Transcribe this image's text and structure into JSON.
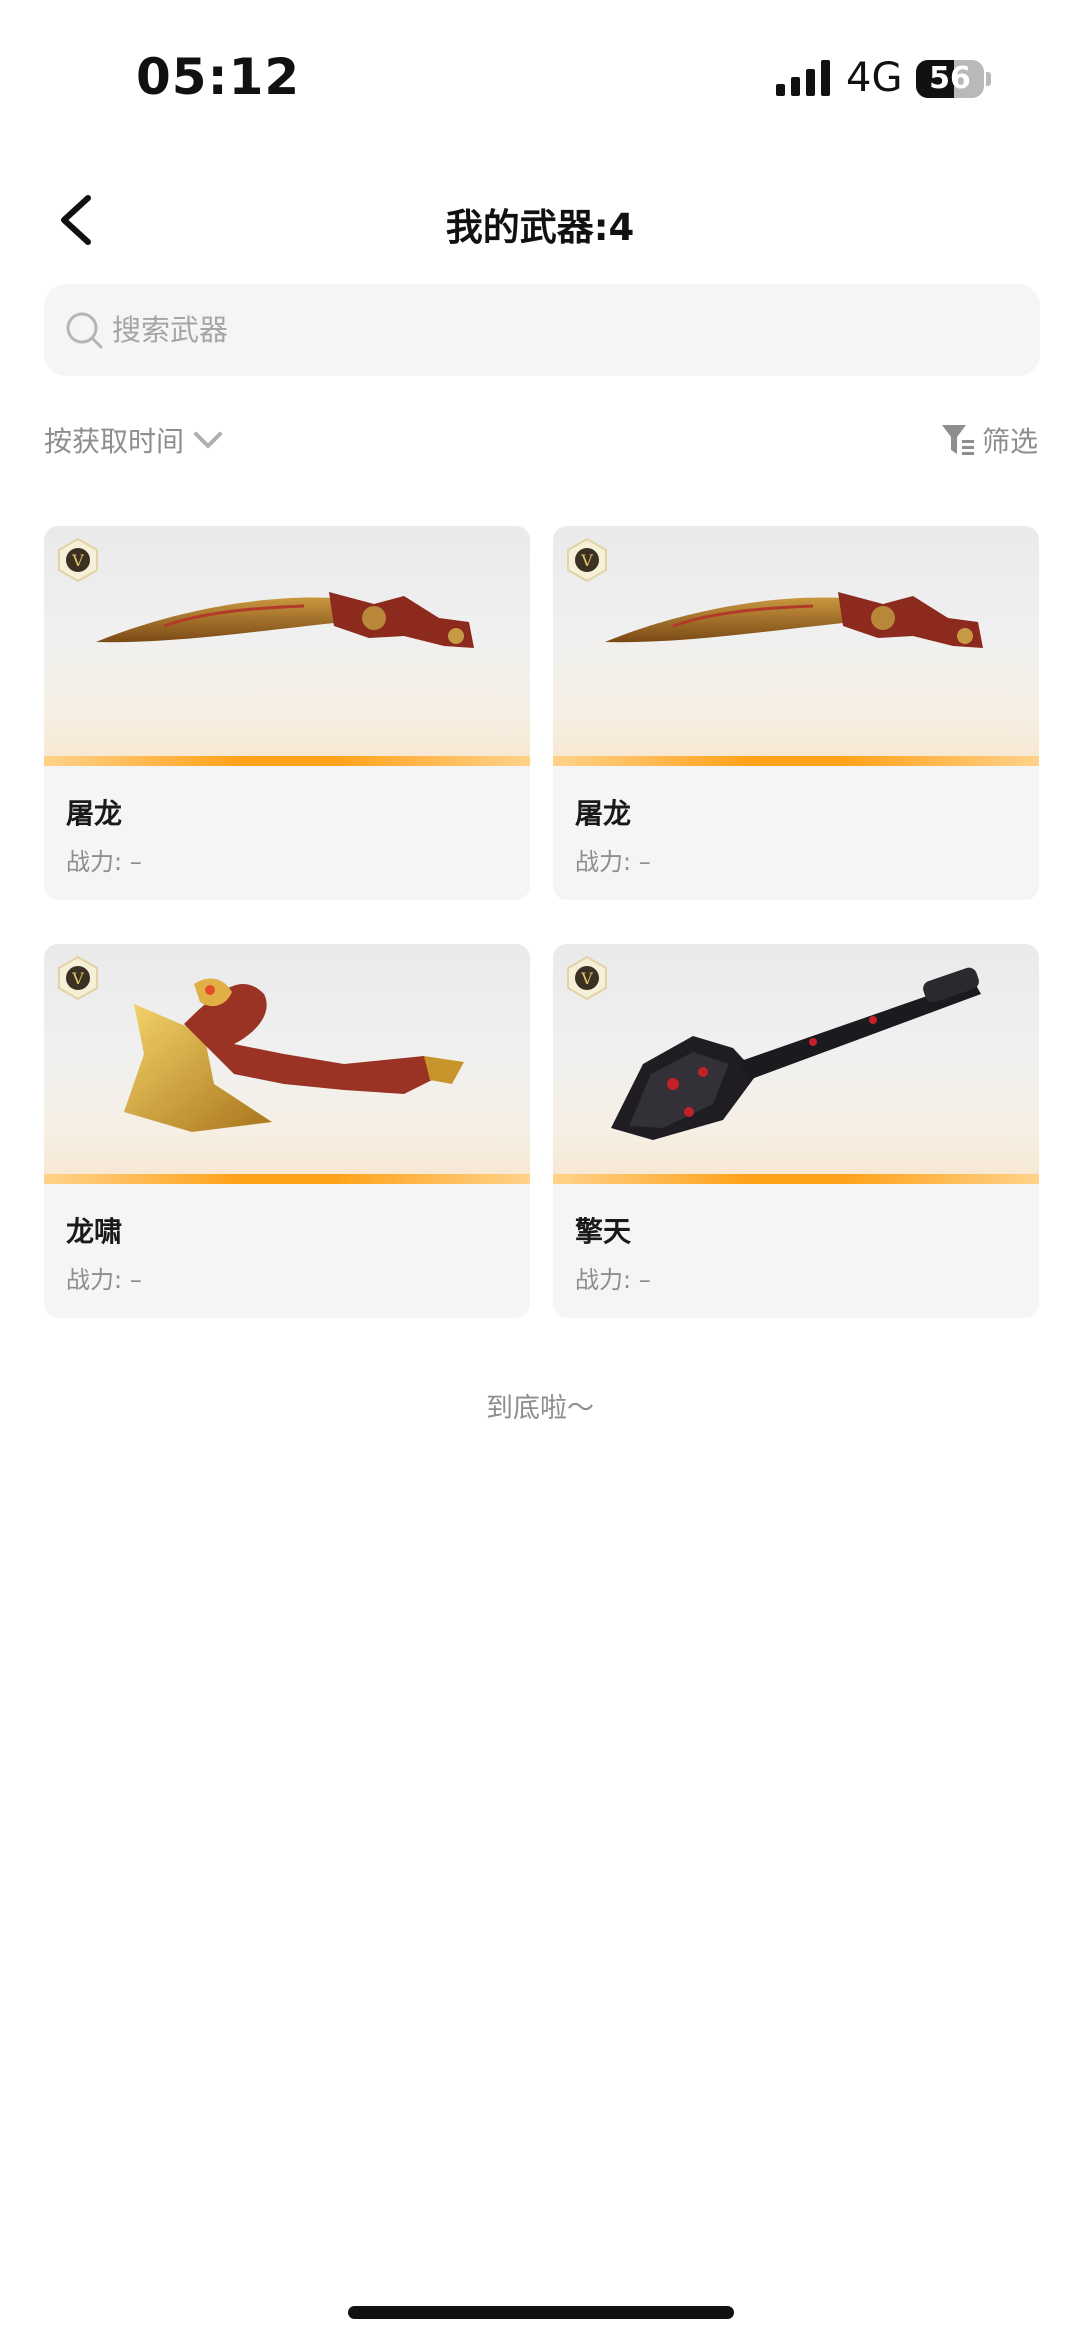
{
  "status_bar": {
    "time": "05:12",
    "network": "4G",
    "battery": "56",
    "battery_level_percent": 56
  },
  "header": {
    "title": "我的武器:4"
  },
  "search": {
    "placeholder": "搜索武器",
    "value": ""
  },
  "toolbar": {
    "sort_label": "按获取时间",
    "filter_label": "筛选"
  },
  "weapons": [
    {
      "name": "屠龙",
      "power": "战力: –",
      "badge": "V",
      "icon": "machete-dragon-icon"
    },
    {
      "name": "屠龙",
      "power": "战力: –",
      "badge": "V",
      "icon": "machete-dragon-icon"
    },
    {
      "name": "龙啸",
      "power": "战力: –",
      "badge": "V",
      "icon": "golden-dragon-axe-icon"
    },
    {
      "name": "擎天",
      "power": "战力: –",
      "badge": "V",
      "icon": "black-red-shovel-icon"
    }
  ],
  "footer": {
    "end_text": "到底啦～"
  },
  "colors": {
    "accent_orange": "#ffa21a",
    "card_bg": "#f5f5f5",
    "muted_text": "#8e8e8e"
  }
}
